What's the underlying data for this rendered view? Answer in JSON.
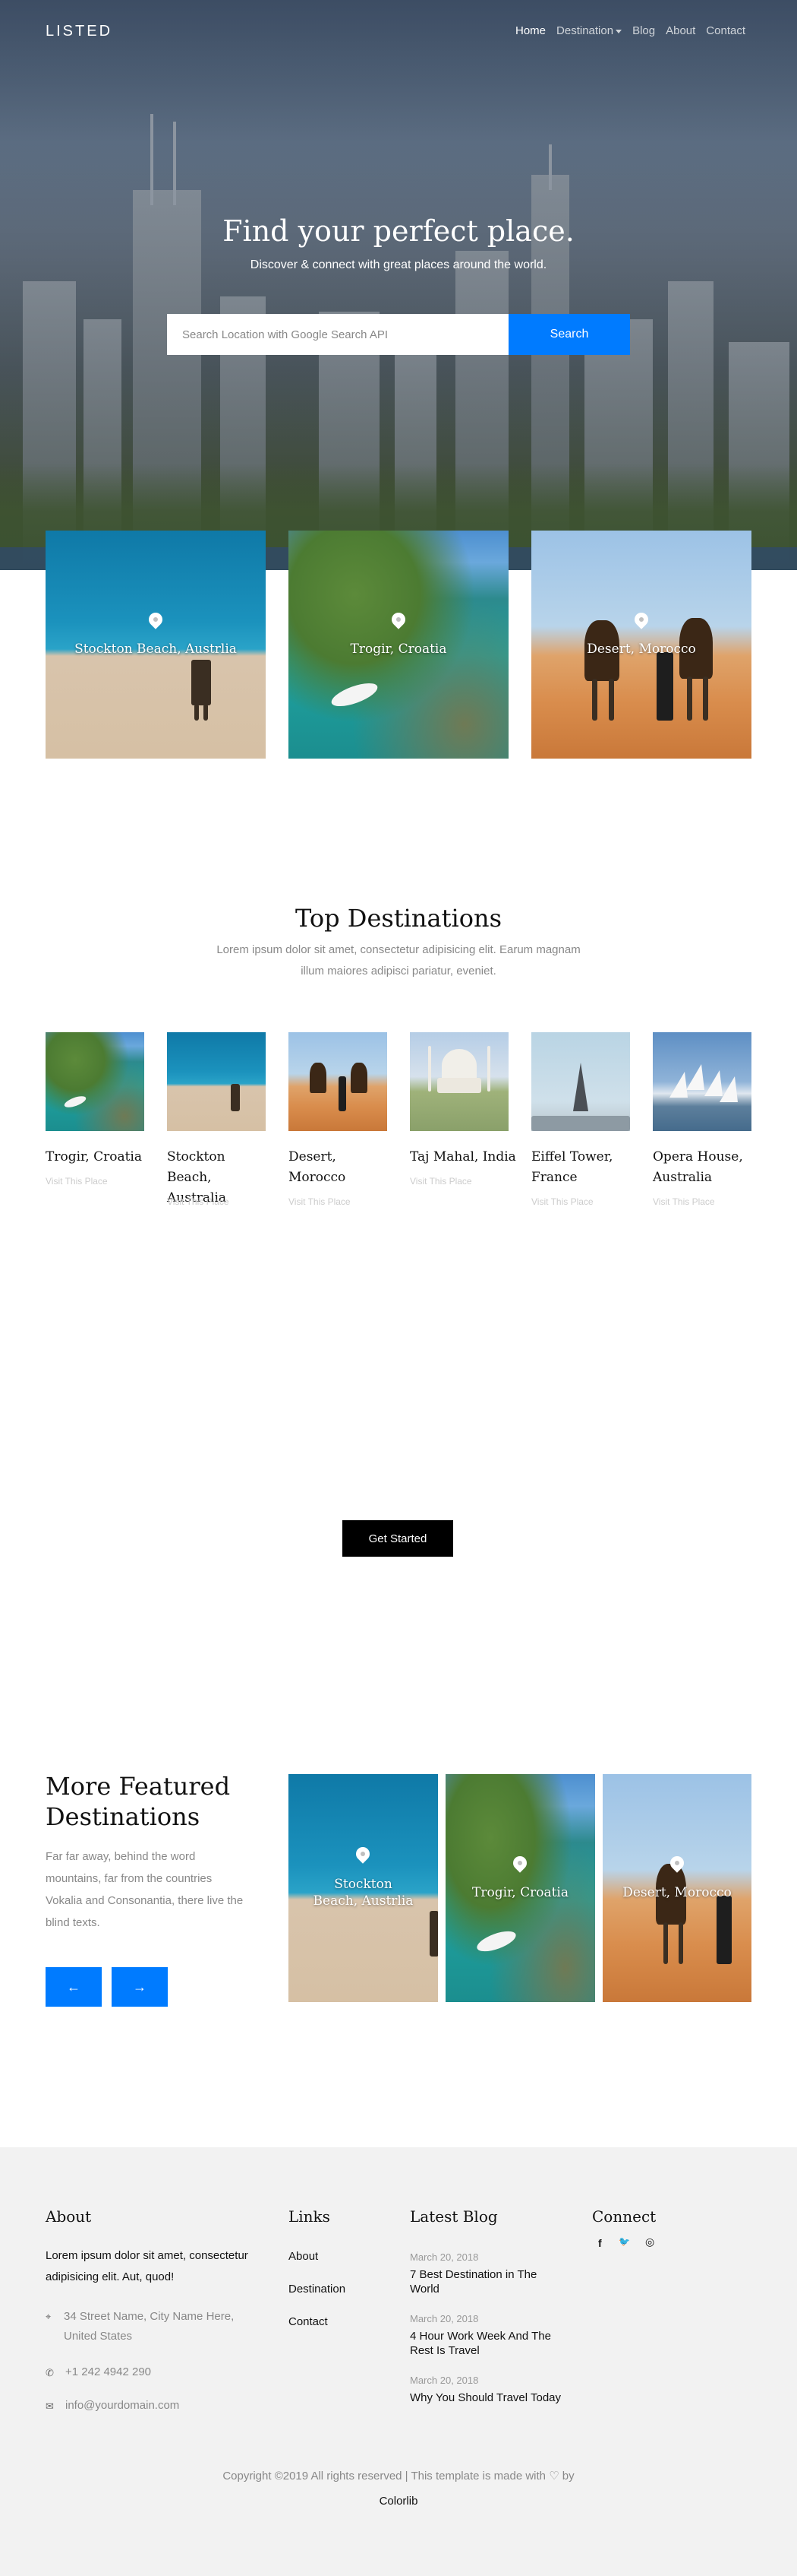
{
  "brand": {
    "logo": "LISTED"
  },
  "nav": {
    "home": "Home",
    "destination": "Destination",
    "blog": "Blog",
    "about": "About",
    "contact": "Contact"
  },
  "hero": {
    "title": "Find your perfect place.",
    "subtitle": "Discover & connect with great places around the world.",
    "search_placeholder": "Search Location with Google Search API",
    "search_button": "Search"
  },
  "featured_tiles": [
    {
      "label": "Stockton Beach, Austrlia"
    },
    {
      "label": "Trogir, Croatia"
    },
    {
      "label": "Desert, Morocco"
    }
  ],
  "top_destinations": {
    "title": "Top Destinations",
    "subtitle": "Lorem ipsum dolor sit amet, consectetur adipisicing elit. Earum magnam illum maiores adipisci pariatur, eveniet.",
    "items": [
      {
        "name": "Trogir, Croatia",
        "link": "Visit This Place"
      },
      {
        "name": "Stockton Beach, Australia",
        "link": "Visit This Place"
      },
      {
        "name": "Desert, Morocco",
        "link": "Visit This Place"
      },
      {
        "name": "Taj Mahal, India",
        "link": "Visit This Place"
      },
      {
        "name": "Eiffel Tower, France",
        "link": "Visit This Place"
      },
      {
        "name": "Opera House, Australia",
        "link": "Visit This Place"
      }
    ]
  },
  "cta": {
    "button": "Get Started"
  },
  "more_featured": {
    "title": "More Featured Destinations",
    "text": "Far far away, behind the word mountains, far from the countries Vokalia and Consonantia, there live the blind texts.",
    "prev_icon": "←",
    "next_icon": "→",
    "tiles": [
      {
        "label": "Stockton Beach, Austrlia"
      },
      {
        "label": "Trogir, Croatia"
      },
      {
        "label": "Desert, Morocco"
      }
    ]
  },
  "footer": {
    "about": {
      "heading": "About",
      "text": "Lorem ipsum dolor sit amet, consectetur adipisicing elit. Aut, quod!",
      "address": "34 Street Name, City Name Here, United States",
      "phone": "+1 242 4942 290",
      "email": "info@yourdomain.com"
    },
    "links": {
      "heading": "Links",
      "items": [
        "About",
        "Destination",
        "Contact"
      ]
    },
    "latest_blog": {
      "heading": "Latest Blog",
      "posts": [
        {
          "date": "March 20, 2018",
          "title": "7 Best Destination in The World"
        },
        {
          "date": "March 20, 2018",
          "title": "4 Hour Work Week And The Rest Is Travel"
        },
        {
          "date": "March 20, 2018",
          "title": "Why You Should Travel Today"
        }
      ]
    },
    "connect": {
      "heading": "Connect",
      "facebook": "f",
      "twitter": "🐦",
      "instagram": "◎"
    },
    "copyright": "Copyright ©2019 All rights reserved | This template is made with ♡ by",
    "copyright_brand": "Colorlib"
  }
}
